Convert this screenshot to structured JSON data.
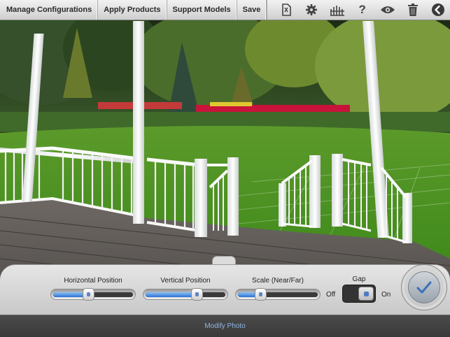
{
  "toolbar": {
    "buttons": [
      "Manage Configurations",
      "Apply Products",
      "Support Models",
      "Save"
    ],
    "icons": [
      "camera-rotate-icon",
      "gear-icon",
      "fence-icon",
      "help-icon",
      "eye-icon",
      "trash-icon",
      "back-icon"
    ]
  },
  "controls": {
    "horizontal": {
      "label": "Horizontal Position",
      "value": 0.44
    },
    "vertical": {
      "label": "Vertical Position",
      "value": 0.63
    },
    "scale": {
      "label": "Scale (Near/Far)",
      "value": 0.29
    },
    "gap": {
      "label": "Gap",
      "off_label": "Off",
      "on_label": "On",
      "state": "on"
    }
  },
  "footer": {
    "label": "Modify Photo"
  },
  "colors": {
    "accent": "#2c6fd3",
    "footer_text": "#8fb5e6"
  }
}
